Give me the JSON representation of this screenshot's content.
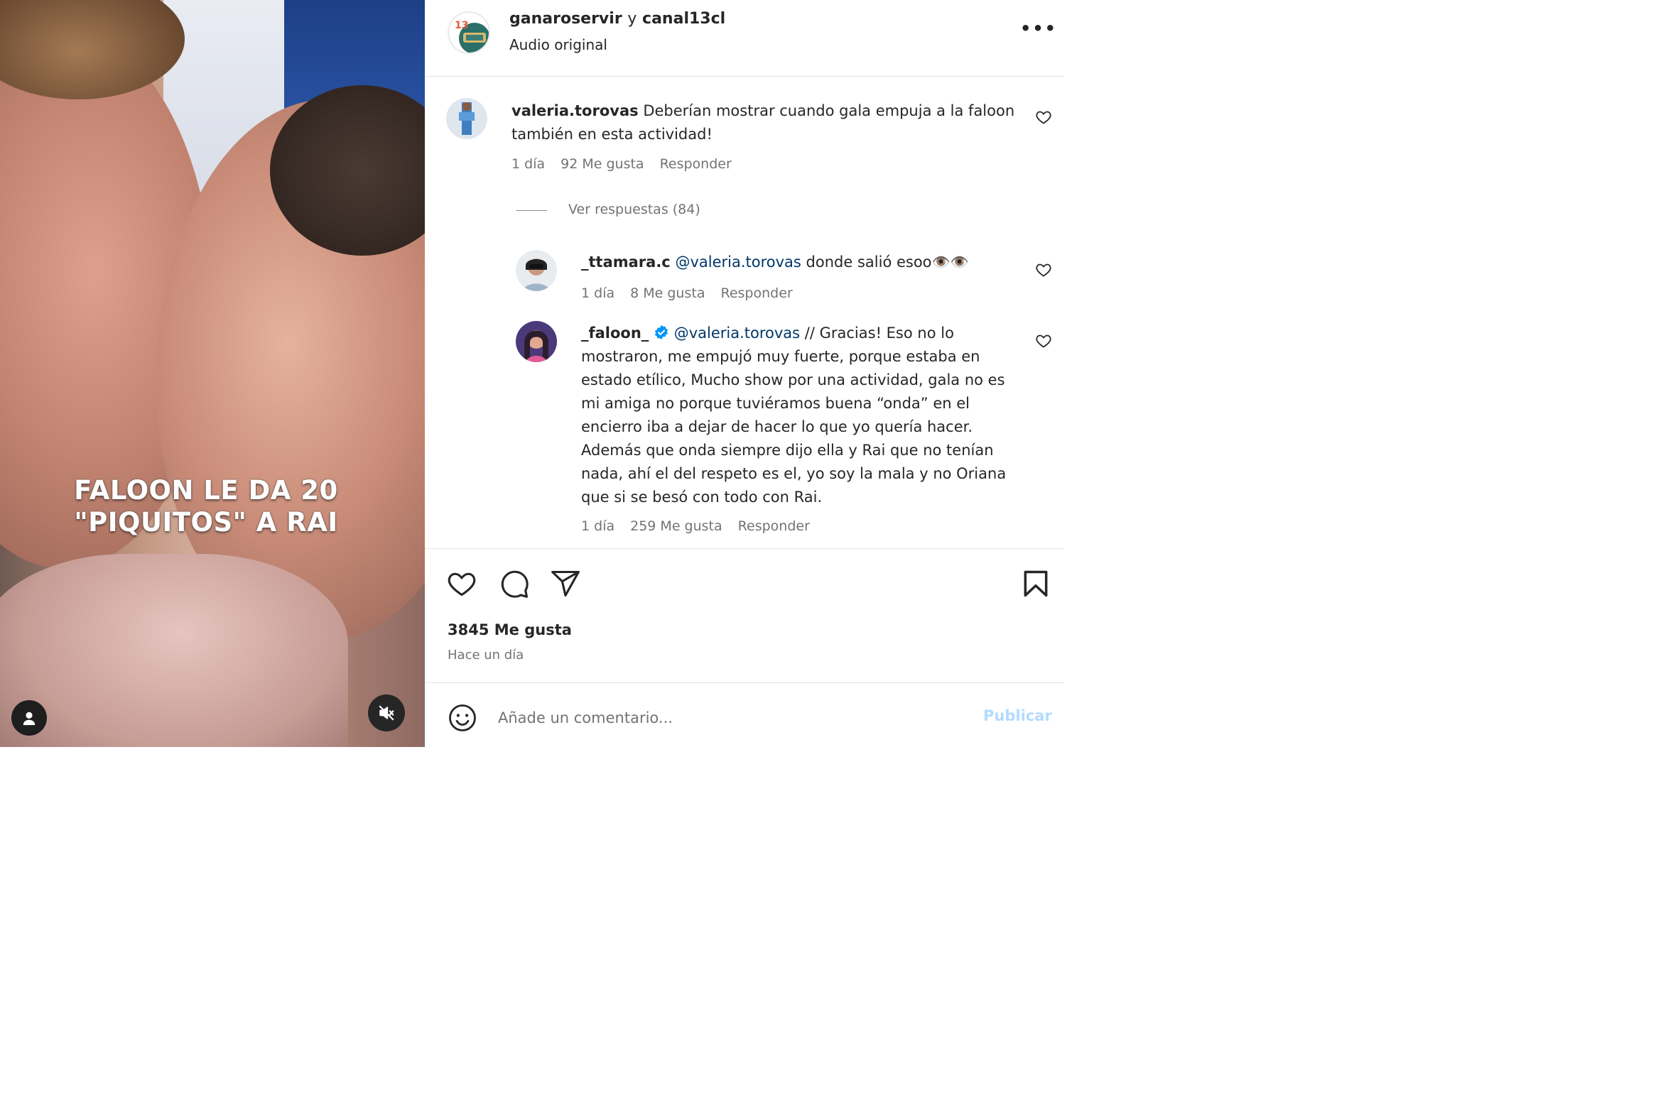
{
  "video": {
    "caption_line1": "FALOON LE DA 20",
    "caption_line2": "\"PIQUITOS\" A RAI"
  },
  "header": {
    "user1": "ganaroservir",
    "joiner": "y",
    "user2": "canal13cl",
    "audio": "Audio original",
    "more": "•••"
  },
  "comments": [
    {
      "username": "valeria.torovas",
      "text": "Deberían mostrar cuando gala empuja a la faloon también en esta actividad!",
      "time": "1 día",
      "likes": "92 Me gusta",
      "reply": "Responder"
    }
  ],
  "view_replies": "Ver respuestas (84)",
  "replies": [
    {
      "username": "_ttamara.c",
      "mention": "@valeria.torovas",
      "text": "donde salió esoo👁️👁️",
      "time": "1 día",
      "likes": "8 Me gusta",
      "reply": "Responder"
    },
    {
      "username": "_faloon_",
      "verified": true,
      "mention": "@valeria.torovas",
      "text": "// Gracias! Eso no lo mostraron, me empujó muy fuerte, porque estaba en estado etílico, Mucho show por una actividad, gala no es mi amiga no porque tuviéramos buena “onda” en el encierro iba a dejar de hacer lo que yo quería hacer. Además que onda siempre dijo ella y Rai que no tenían nada, ahí el del respeto es el, yo soy la mala y no Oriana que si se besó con todo con Rai.",
      "time": "1 día",
      "likes": "259 Me gusta",
      "reply": "Responder"
    }
  ],
  "post": {
    "likes": "3845 Me gusta",
    "time_ago": "Hace un día"
  },
  "comment_box": {
    "placeholder": "Añade un comentario...",
    "publish": "Publicar"
  },
  "colors": {
    "mention": "#00376b",
    "verified": "#0095f6",
    "publish_disabled": "#b3dbff",
    "secondary_text": "#737373"
  },
  "icons": [
    "ellipsis-icon",
    "heart-icon",
    "comment-icon",
    "share-icon",
    "bookmark-icon",
    "emoji-icon",
    "user-icon",
    "mute-icon",
    "verified-badge-icon"
  ]
}
